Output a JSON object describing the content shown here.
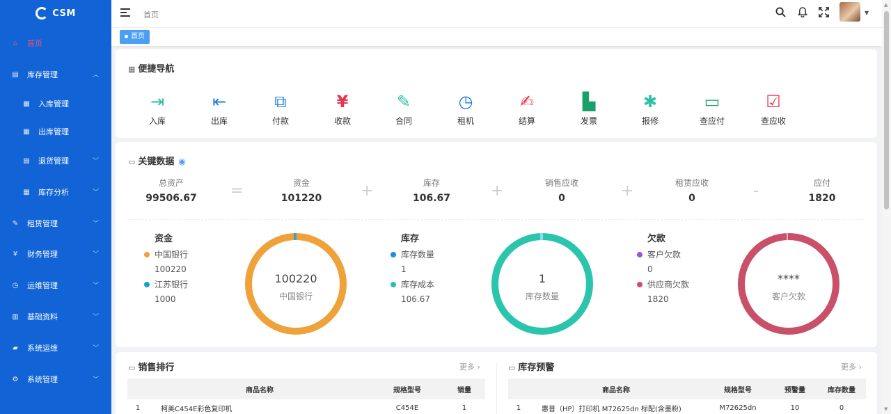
{
  "app": {
    "logo_text": "CSM"
  },
  "sidebar": {
    "items": [
      {
        "label": "首页",
        "icon": "home-icon",
        "active": true
      },
      {
        "label": "库存管理",
        "icon": "document-icon"
      },
      {
        "label": "入库管理",
        "icon": "grid-icon"
      },
      {
        "label": "出库管理",
        "icon": "grid-icon"
      },
      {
        "label": "退货管理",
        "icon": "document-icon"
      },
      {
        "label": "库存分析",
        "icon": "grid-icon"
      },
      {
        "label": "租赁管理",
        "icon": "edit-icon"
      },
      {
        "label": "财务管理",
        "icon": "yen-icon"
      },
      {
        "label": "运维管理",
        "icon": "clock-icon"
      },
      {
        "label": "基础资料",
        "icon": "file-icon"
      },
      {
        "label": "系统运维",
        "icon": "folder-icon"
      },
      {
        "label": "系统管理",
        "icon": "gear-icon"
      }
    ]
  },
  "topbar": {
    "breadcrumb": "首页"
  },
  "tabs": [
    {
      "label": "首页"
    }
  ],
  "quick_nav": {
    "title": "便捷导航",
    "items": [
      {
        "label": "入库",
        "icon": "inbound-icon",
        "color": "#2bbfa6"
      },
      {
        "label": "出库",
        "icon": "outbound-icon",
        "color": "#1f7fd9"
      },
      {
        "label": "付款",
        "icon": "payment-icon",
        "color": "#1f7fd9"
      },
      {
        "label": "收款",
        "icon": "yen-icon",
        "color": "#e8344e"
      },
      {
        "label": "合同",
        "icon": "contract-icon",
        "color": "#2bbfa6"
      },
      {
        "label": "租机",
        "icon": "rental-icon",
        "color": "#1f7fd9"
      },
      {
        "label": "结算",
        "icon": "settle-icon",
        "color": "#e8344e"
      },
      {
        "label": "发票",
        "icon": "invoice-icon",
        "color": "#1aa06b"
      },
      {
        "label": "报修",
        "icon": "bug-icon",
        "color": "#2bbfa6"
      },
      {
        "label": "查应付",
        "icon": "monitor-icon",
        "color": "#1aa06b"
      },
      {
        "label": "查应收",
        "icon": "receivable-icon",
        "color": "#e8344e"
      }
    ]
  },
  "key_data": {
    "title": "关键数据",
    "kpis": [
      {
        "label": "总资产",
        "value": "99506.67"
      },
      {
        "label": "资金",
        "value": "101220"
      },
      {
        "label": "库存",
        "value": "106.67"
      },
      {
        "label": "销售应收",
        "value": "0"
      },
      {
        "label": "租赁应收",
        "value": "0"
      },
      {
        "label": "应付",
        "value": "1820"
      }
    ],
    "operators": [
      "=",
      "+",
      "+",
      "+",
      "-"
    ],
    "groups": [
      {
        "title": "资金",
        "legend": [
          {
            "name": "中国银行",
            "value": "100220",
            "color": "#f0a23a"
          },
          {
            "name": "江苏银行",
            "value": "1000",
            "color": "#1aa0c8"
          }
        ],
        "ring": {
          "value": "100220",
          "label": "中国银行",
          "color": "#f0a23a"
        }
      },
      {
        "title": "库存",
        "legend": [
          {
            "name": "库存数量",
            "value": "1",
            "color": "#1a8fd9"
          },
          {
            "name": "库存成本",
            "value": "106.67",
            "color": "#2bbfa6"
          }
        ],
        "ring": {
          "value": "1",
          "label": "库存数量",
          "color": "#2bc4ad"
        }
      },
      {
        "title": "欠款",
        "legend": [
          {
            "name": "客户欠款",
            "value": "0",
            "color": "#8e5ad6"
          },
          {
            "name": "供应商欠款",
            "value": "1820",
            "color": "#c8506a"
          }
        ],
        "ring": {
          "value": "****",
          "label": "客户欠款",
          "color": "#c95068"
        }
      }
    ]
  },
  "sales_rank": {
    "title": "销售排行",
    "more": "更多",
    "columns": [
      "",
      "商品名称",
      "规格型号",
      "销量"
    ],
    "rows": [
      [
        "1",
        "柯美C454E彩色复印机",
        "C454E",
        "1"
      ]
    ]
  },
  "stock_alert": {
    "title": "库存预警",
    "more": "更多",
    "columns": [
      "",
      "商品名称",
      "规格型号",
      "预警量",
      "库存数量"
    ],
    "rows": [
      [
        "1",
        "惠普（HP）打印机 M72625dn 标配(含墨粉)",
        "M72625dn",
        "10",
        "0"
      ]
    ]
  }
}
